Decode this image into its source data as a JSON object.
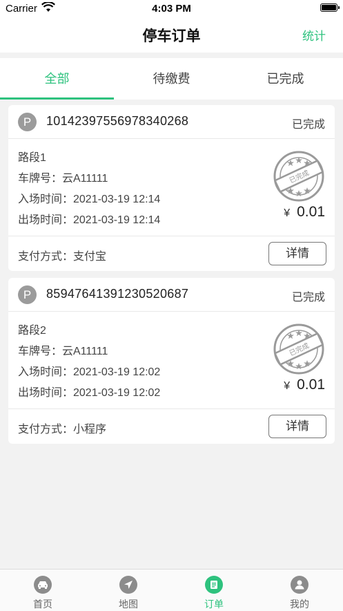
{
  "status_bar": {
    "carrier": "Carrier",
    "time": "4:03 PM"
  },
  "nav": {
    "title": "停车订单",
    "stats_label": "统计"
  },
  "tabs": [
    {
      "label": "全部",
      "active": true
    },
    {
      "label": "待缴费",
      "active": false
    },
    {
      "label": "已完成",
      "active": false
    }
  ],
  "orders": [
    {
      "badge": "P",
      "order_no": "10142397556978340268",
      "status": "已完成",
      "road": "路段1",
      "plate": "车牌号：云A11111",
      "entry": "入场时间：2021-03-19 12:14",
      "exit": "出场时间：2021-03-19 12:14",
      "stamp_text": "已完成",
      "currency": "¥",
      "amount": "0.01",
      "payment": "支付方式：支付宝",
      "detail_label": "详情"
    },
    {
      "badge": "P",
      "order_no": "85947641391230520687",
      "status": "已完成",
      "road": "路段2",
      "plate": "车牌号：云A11111",
      "entry": "入场时间：2021-03-19 12:02",
      "exit": "出场时间：2021-03-19 12:02",
      "stamp_text": "已完成",
      "currency": "¥",
      "amount": "0.01",
      "payment": "支付方式：小程序",
      "detail_label": "详情"
    }
  ],
  "tabbar": [
    {
      "label": "首页",
      "icon": "car-icon",
      "active": false
    },
    {
      "label": "地图",
      "icon": "navigation-arrow-icon",
      "active": false
    },
    {
      "label": "订单",
      "icon": "order-list-icon",
      "active": true
    },
    {
      "label": "我的",
      "icon": "user-icon",
      "active": false
    }
  ],
  "colors": {
    "accent": "#2ec27e",
    "icon_gray": "#8c8c8c",
    "background": "#f2f2f2"
  }
}
